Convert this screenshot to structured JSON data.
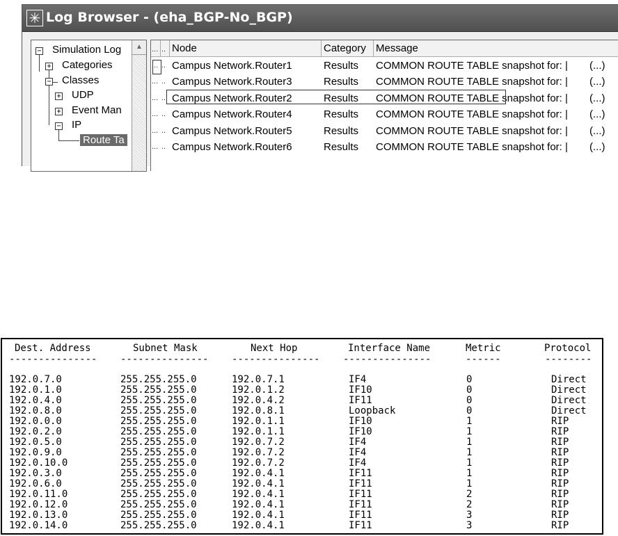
{
  "window": {
    "title": "Log Browser - (eha_BGP-No_BGP)",
    "icon": "asterisk-icon"
  },
  "tree": {
    "root": "Simulation Log",
    "categories": "Categories",
    "classes": "Classes",
    "udp": "UDP",
    "event_manager": "Event Man",
    "ip": "IP",
    "route_table": "Route Ta"
  },
  "grid": {
    "headers": [
      "...",
      "..",
      "Node",
      "Category",
      "Message"
    ],
    "rows": [
      {
        "c0": "...",
        "c1": "..",
        "node": "Campus Network.Router1",
        "category": "Results",
        "message": "COMMON ROUTE TABLE snapshot for:  |",
        "more": "(...)"
      },
      {
        "c0": "...",
        "c1": "..",
        "node": "Campus Network.Router3",
        "category": "Results",
        "message": "COMMON ROUTE TABLE snapshot for:  |",
        "more": "(...)"
      },
      {
        "c0": "...",
        "c1": "..",
        "node": "Campus Network.Router2",
        "category": "Results",
        "message": "COMMON ROUTE TABLE snapshot for:  |",
        "more": "(...)"
      },
      {
        "c0": "...",
        "c1": "..",
        "node": "Campus Network.Router4",
        "category": "Results",
        "message": "COMMON ROUTE TABLE snapshot for:  |",
        "more": "(...)"
      },
      {
        "c0": "...",
        "c1": "..",
        "node": "Campus Network.Router5",
        "category": "Results",
        "message": "COMMON ROUTE TABLE snapshot for:  |",
        "more": "(...)"
      },
      {
        "c0": "...",
        "c1": "..",
        "node": "Campus Network.Router6",
        "category": "Results",
        "message": "COMMON ROUTE TABLE snapshot for:  |",
        "more": "(...)"
      }
    ]
  },
  "route_table": {
    "headers": [
      "Dest. Address",
      "Subnet Mask",
      "Next Hop",
      "Interface Name",
      "Metric",
      "Protocol"
    ],
    "dashes": [
      "---------------",
      "---------------",
      "---------------",
      "---------------",
      "------",
      "--------"
    ],
    "rows": [
      [
        "192.0.7.0",
        "255.255.255.0",
        "192.0.7.1",
        "IF4",
        "0",
        "Direct"
      ],
      [
        "192.0.1.0",
        "255.255.255.0",
        "192.0.1.2",
        "IF10",
        "0",
        "Direct"
      ],
      [
        "192.0.4.0",
        "255.255.255.0",
        "192.0.4.2",
        "IF11",
        "0",
        "Direct"
      ],
      [
        "192.0.8.0",
        "255.255.255.0",
        "192.0.8.1",
        "Loopback",
        "0",
        "Direct"
      ],
      [
        "192.0.0.0",
        "255.255.255.0",
        "192.0.1.1",
        "IF10",
        "1",
        "RIP"
      ],
      [
        "192.0.2.0",
        "255.255.255.0",
        "192.0.1.1",
        "IF10",
        "1",
        "RIP"
      ],
      [
        "192.0.5.0",
        "255.255.255.0",
        "192.0.7.2",
        "IF4",
        "1",
        "RIP"
      ],
      [
        "192.0.9.0",
        "255.255.255.0",
        "192.0.7.2",
        "IF4",
        "1",
        "RIP"
      ],
      [
        "192.0.10.0",
        "255.255.255.0",
        "192.0.7.2",
        "IF4",
        "1",
        "RIP"
      ],
      [
        "192.0.3.0",
        "255.255.255.0",
        "192.0.4.1",
        "IF11",
        "1",
        "RIP"
      ],
      [
        "192.0.6.0",
        "255.255.255.0",
        "192.0.4.1",
        "IF11",
        "1",
        "RIP"
      ],
      [
        "192.0.11.0",
        "255.255.255.0",
        "192.0.4.1",
        "IF11",
        "2",
        "RIP"
      ],
      [
        "192.0.12.0",
        "255.255.255.0",
        "192.0.4.1",
        "IF11",
        "2",
        "RIP"
      ],
      [
        "192.0.13.0",
        "255.255.255.0",
        "192.0.4.1",
        "IF11",
        "3",
        "RIP"
      ],
      [
        "192.0.14.0",
        "255.255.255.0",
        "192.0.4.1",
        "IF11",
        "3",
        "RIP"
      ]
    ]
  }
}
